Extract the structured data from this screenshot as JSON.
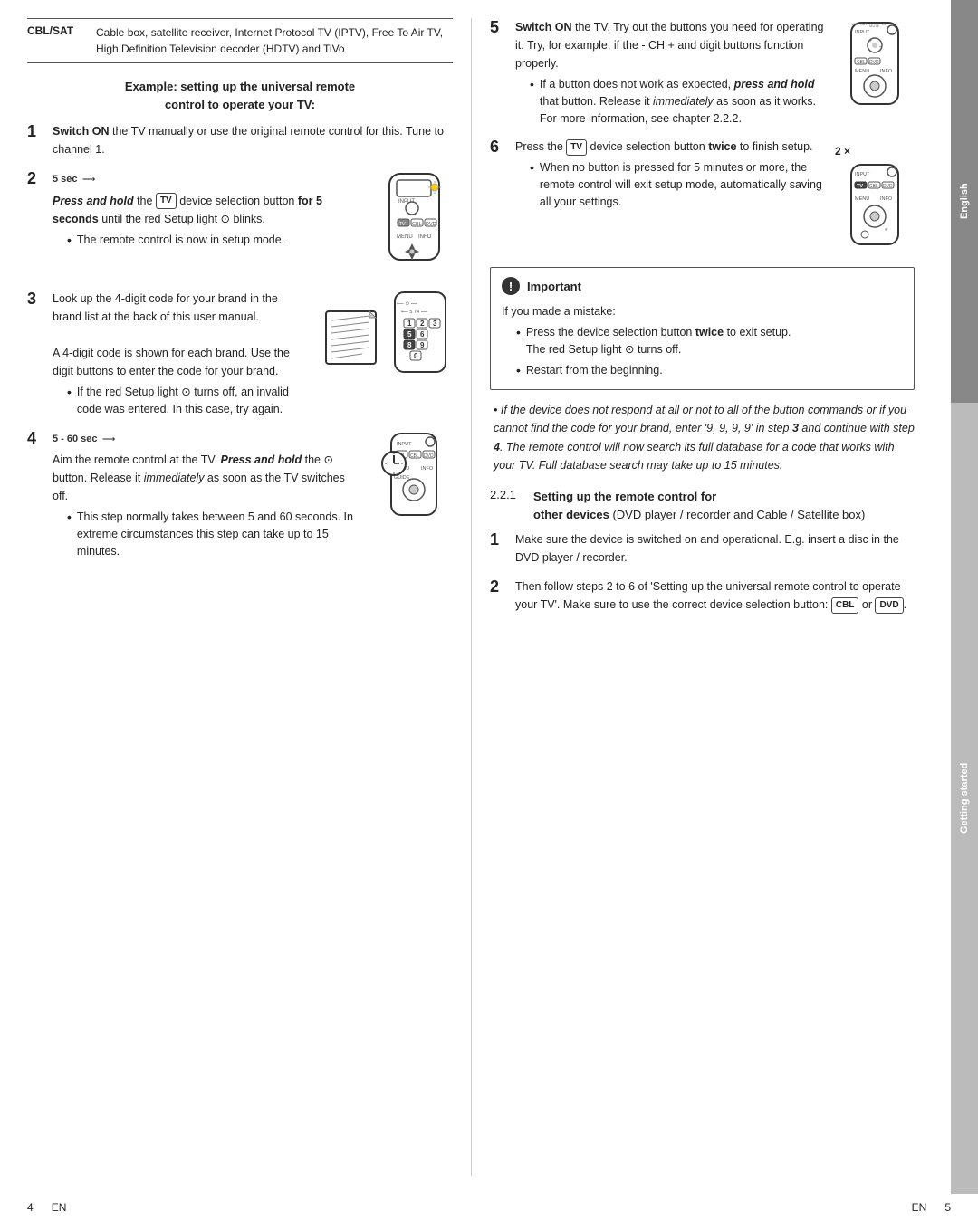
{
  "sidebar": {
    "english_label": "English",
    "getting_started_label": "Getting started"
  },
  "cbl_sat": {
    "label": "CBL/SAT",
    "description": "Cable box, satellite receiver, Internet Protocol TV (IPTV), Free To Air TV, High Definition Television decoder (HDTV) and TiVo"
  },
  "example_heading": {
    "line1": "Example: setting up the universal remote",
    "line2": "control to operate your TV:"
  },
  "steps_left": [
    {
      "number": "1",
      "text": "Switch ON the TV manually or use the original remote control for this. Tune to channel 1."
    },
    {
      "number": "2",
      "label_time": "5 sec",
      "text_bold": "Press and hold",
      "text1": " the",
      "device_btn": "TV",
      "text2": " device selection button",
      "text3_bold": " for 5 seconds",
      "text4": " until the red Setup light ⊙ blinks.",
      "bullet": "The remote control is now in setup mode."
    },
    {
      "number": "3",
      "text_intro": "Look up the 4-digit code for your brand in the brand list at the back of this user manual.",
      "text_cont": "A 4-digit code is shown for each brand. Use the digit buttons to enter the code for your brand.",
      "bullet_text": "If the red Setup light ⊙ turns off, an invalid code was entered. In this case, try again."
    },
    {
      "number": "4",
      "label_time": "5 - 60 sec",
      "text_intro": "Aim the remote control at the TV.",
      "text_bold": "Press and hold",
      "text_cont": " the ⊙ button. Release it",
      "text_italic": " immediately",
      "text_end": " as soon as the TV switches off.",
      "bullet": "This step normally takes between 5 and 60 seconds. In extreme circumstances this step can take up to 15 minutes."
    }
  ],
  "steps_right": [
    {
      "number": "5",
      "text_bold": "Switch ON",
      "text1": " the TV. Try out the buttons you need for operating it. Try, for example, if the - CH + and digit buttons function properly.",
      "bullet1_text_bold": "and hold",
      "bullet1_text": "If a button does not work as expected, press and hold that button. Release it immediately as soon as it works. For more information, see chapter 2.2.2.",
      "bullet1_bold_start": "press",
      "bullet1_italic": "immediately"
    },
    {
      "number": "6",
      "text1": "Press the",
      "device_btn": "TV",
      "text2": " device selection button",
      "text_bold": " twice",
      "text3": " to finish setup.",
      "two_x": "2 ×",
      "bullet": "When no button is pressed for 5 minutes or more, the remote control will exit setup mode, automatically saving all your settings."
    }
  ],
  "important_box": {
    "title": "Important",
    "intro": "If you made a mistake:",
    "bullet1": "Press the device selection button twice to exit setup.\nThe red Setup light ⊙ turns off.",
    "bullet1_bold": "twice",
    "bullet2": "Restart from the beginning."
  },
  "italic_block": {
    "text": "If the device does not respond at all or not to all of the button commands or if you cannot find the code for your brand, enter '9, 9, 9, 9' in step 3 and continue with step 4. The remote control will now search its full database for a code that works with your TV. Full database search may take up to 15 minutes."
  },
  "section_221": {
    "number": "2.2.1",
    "title_bold": "Setting up the remote control for",
    "title_cont": " other devices",
    "title_rest": " (DVD player / recorder and Cable / Satellite box)"
  },
  "steps_221": [
    {
      "number": "1",
      "text": "Make sure the device is switched on and operational. E.g. insert a disc in the DVD player / recorder."
    },
    {
      "number": "2",
      "text_intro": "Then follow steps 2 to 6 of 'Setting up the universal remote control to operate your TV'. Make sure to use the correct device selection button:",
      "btn1": "CBL",
      "text_mid": " or ",
      "btn2": "DVD",
      "text_end": "."
    }
  ],
  "footer": {
    "left_page": "4",
    "left_lang": "EN",
    "right_lang": "EN",
    "right_page": "5"
  }
}
